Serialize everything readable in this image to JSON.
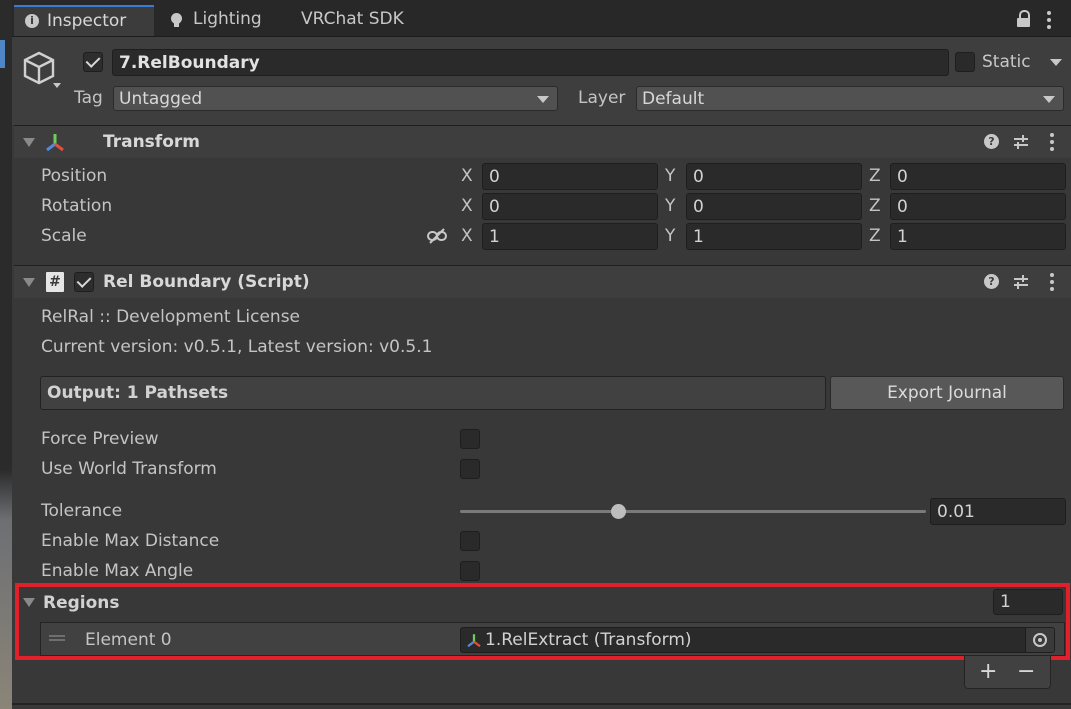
{
  "tabs": [
    {
      "label": "Inspector",
      "icon": "info-icon"
    },
    {
      "label": "Lighting",
      "icon": "lightbulb-icon"
    },
    {
      "label": "VRChat SDK"
    }
  ],
  "gameobject": {
    "name": "7.RelBoundary",
    "active": true,
    "static_label": "Static",
    "static": false,
    "tag_label": "Tag",
    "tag_value": "Untagged",
    "layer_label": "Layer",
    "layer_value": "Default"
  },
  "transform": {
    "title": "Transform",
    "rows": [
      {
        "label": "Position",
        "x": "0",
        "y": "0",
        "z": "0"
      },
      {
        "label": "Rotation",
        "x": "0",
        "y": "0",
        "z": "0"
      },
      {
        "label": "Scale",
        "x": "1",
        "y": "1",
        "z": "1"
      }
    ],
    "axes": {
      "x": "X",
      "y": "Y",
      "z": "Z"
    }
  },
  "script": {
    "title": "Rel Boundary (Script)",
    "enabled": true,
    "license": "RelRal :: Development License",
    "version": "Current version: v0.5.1, Latest version: v0.5.1",
    "output": "Output: 1 Pathsets",
    "export_button": "Export Journal",
    "force_preview_label": "Force Preview",
    "force_preview": false,
    "use_world_label": "Use World Transform",
    "use_world": false,
    "tolerance_label": "Tolerance",
    "tolerance_value": "0.01",
    "tolerance_slider_fraction": 0.34,
    "max_distance_label": "Enable Max Distance",
    "max_distance": false,
    "max_angle_label": "Enable Max Angle",
    "max_angle": false,
    "regions_label": "Regions",
    "regions_count": "1",
    "element_label": "Element 0",
    "element_value": "1.RelExtract (Transform)",
    "add_label": "+",
    "remove_label": "−"
  },
  "colors": {
    "highlight": "#e0202a",
    "tab_accent": "#3a7bd5"
  }
}
